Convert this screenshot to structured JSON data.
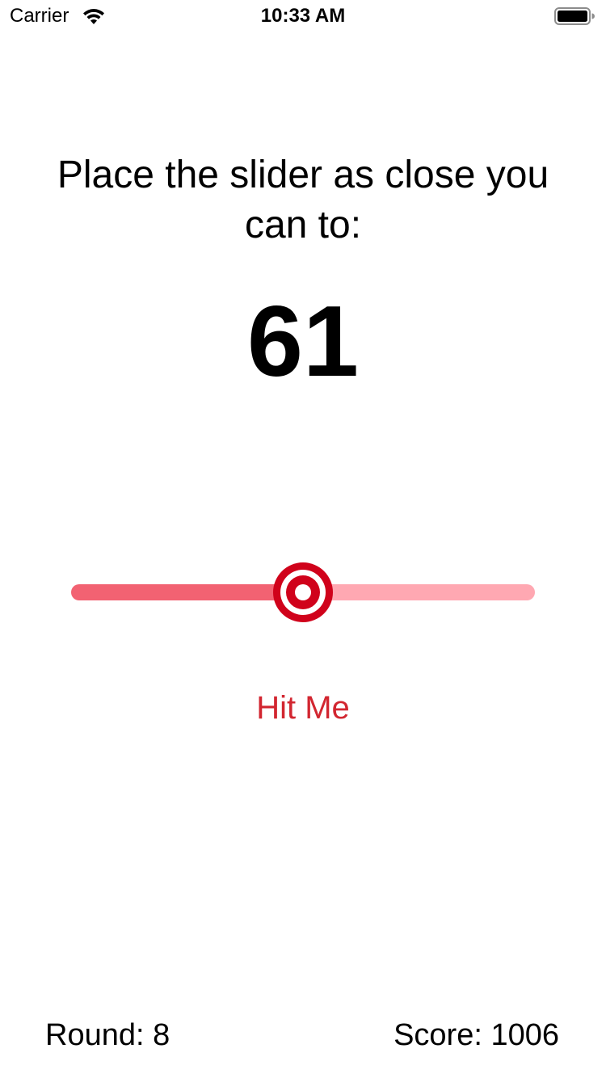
{
  "status_bar": {
    "carrier": "Carrier",
    "wifi_icon": "wifi-icon",
    "time": "10:33 AM",
    "battery_icon": "battery-full-icon"
  },
  "game": {
    "prompt": "Place the slider as close you can to:",
    "target_value": "61",
    "slider": {
      "value_fraction": 0.5,
      "min_track_color": "#f26272",
      "max_track_color": "#ffa8b2",
      "thumb_icon": "target-icon",
      "thumb_color": "#d0021b"
    },
    "hit_button_label": "Hit Me",
    "hit_button_color": "#d22630",
    "round_label": "Round: 8",
    "score_label": "Score: 1006"
  }
}
